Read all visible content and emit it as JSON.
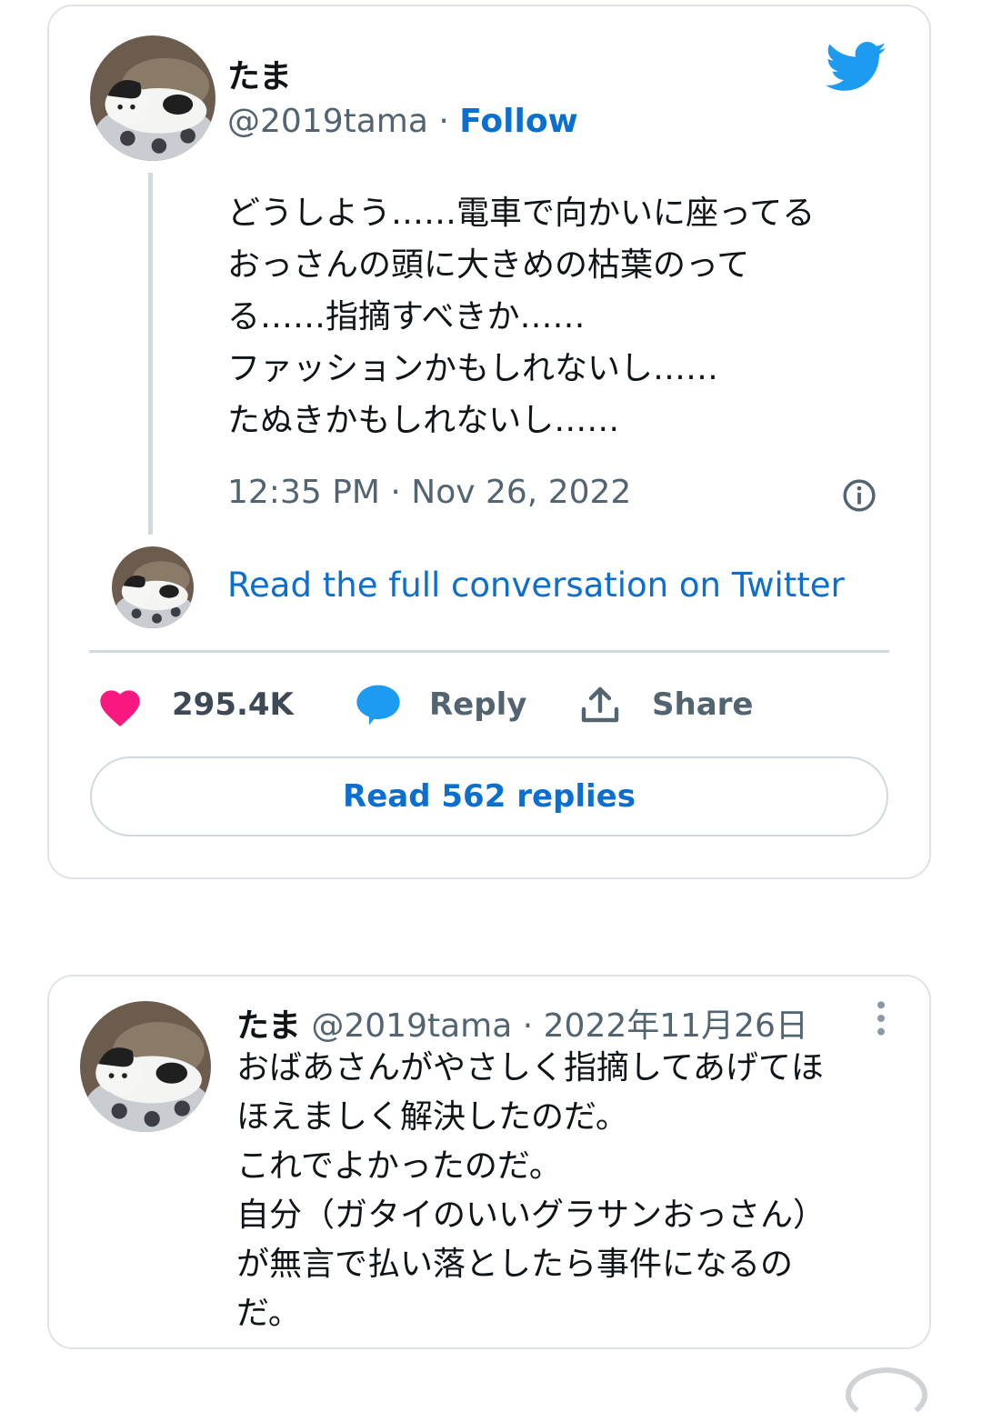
{
  "tweet": {
    "author_name": "たま",
    "author_handle": "@2019tama",
    "separator": "·",
    "follow_label": "Follow",
    "text": "どうしよう……電車で向かいに座ってる\nおっさんの頭に大きめの枯葉のって\nる……指摘すべきか……\nファッションかもしれないし……\nたぬきかもしれないし……",
    "timestamp": "12:35 PM · Nov 26, 2022",
    "read_conversation_label": "Read the full conversation on Twitter",
    "likes_count": "295.4K",
    "reply_label": "Reply",
    "share_label": "Share",
    "read_replies_label": "Read 562 replies",
    "like_color": "#f91880",
    "accent_color": "#1d9bf0",
    "icons": [
      "twitter-bird-icon",
      "info-icon",
      "heart-icon",
      "reply-bubble-icon",
      "share-icon"
    ]
  },
  "reply_tweet": {
    "author_name": "たま",
    "author_handle": "@2019tama",
    "separator": "·",
    "date": "2022年11月26日",
    "text": "おばあさんがやさしく指摘してあげてほ\nほえましく解決したのだ。\nこれでよかったのだ。\n自分（ガタイのいいグラサンおっさん）\nが無言で払い落としたら事件になるの\nだ。",
    "icons": [
      "more-vertical-icon"
    ]
  }
}
